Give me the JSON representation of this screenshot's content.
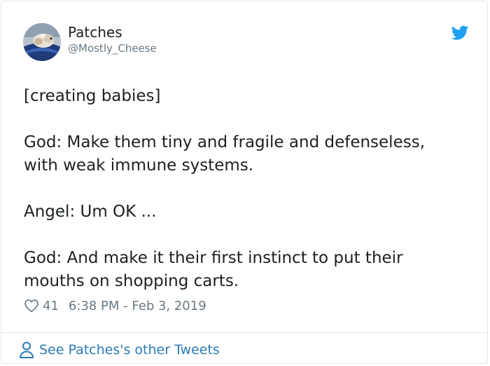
{
  "author": {
    "name": "Patches",
    "handle": "@Mostly_Cheese",
    "avatar_icon": "avatar-photo"
  },
  "brand": {
    "icon": "twitter-bird-icon",
    "color": "#1da1f2"
  },
  "tweet": {
    "lines": [
      "[creating babies]",
      "God: Make them tiny and fragile and defenseless,",
      "with weak immune systems.",
      "Angel: Um OK ...",
      "God: And make it their first instinct to put their",
      "mouths on shopping carts."
    ]
  },
  "meta": {
    "likes": "41",
    "timestamp": "6:38 PM - Feb 3, 2019"
  },
  "footer": {
    "link_label": "See Patches's other Tweets",
    "link_color": "#2b7bb9"
  }
}
